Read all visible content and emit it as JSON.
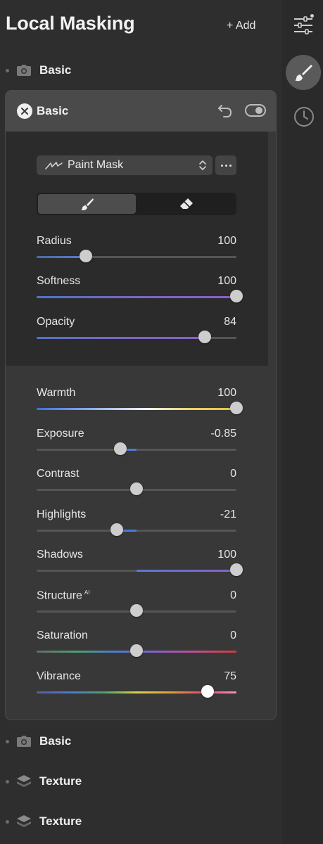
{
  "header": {
    "title": "Local Masking",
    "add_label": "+ Add"
  },
  "rows_top": [
    {
      "label": "Basic",
      "icon": "camera-icon"
    }
  ],
  "panel": {
    "title": "Basic",
    "mask_tool": {
      "label": "Paint Mask",
      "more": "more-icon"
    },
    "brush_modes": [
      "brush-icon",
      "eraser-icon"
    ],
    "mask_sliders": [
      {
        "label": "Radius",
        "value": "100",
        "pct": 0.245
      },
      {
        "label": "Softness",
        "value": "100",
        "pct": 1.0
      },
      {
        "label": "Opacity",
        "value": "84",
        "pct": 0.84
      }
    ],
    "adjust_sliders": [
      {
        "label": "Warmth",
        "value": "100",
        "pct": 1.0
      },
      {
        "label": "Exposure",
        "value": "-0.85",
        "pct": 0.42
      },
      {
        "label": "Contrast",
        "value": "0",
        "pct": 0.5
      },
      {
        "label": "Highlights",
        "value": "-21",
        "pct": 0.4
      },
      {
        "label": "Shadows",
        "value": "100",
        "pct": 1.0
      },
      {
        "label": "Structure",
        "sup": "AI",
        "value": "0",
        "pct": 0.5
      },
      {
        "label": "Saturation",
        "value": "0",
        "pct": 0.5
      },
      {
        "label": "Vibrance",
        "value": "75",
        "pct": 0.855
      }
    ]
  },
  "rows_bottom": [
    {
      "label": "Basic",
      "icon": "camera-icon"
    },
    {
      "label": "Texture",
      "icon": "layers-icon"
    },
    {
      "label": "Texture",
      "icon": "layers-icon"
    }
  ],
  "rail": [
    "adjust-icon",
    "brush-icon",
    "history-icon"
  ],
  "colors": {
    "panel": "#383838",
    "header": "#4a4a4a",
    "thumb": "#cdcdcd",
    "accent_purple": "#8a5fc9",
    "accent_blue": "#5a78d6"
  }
}
